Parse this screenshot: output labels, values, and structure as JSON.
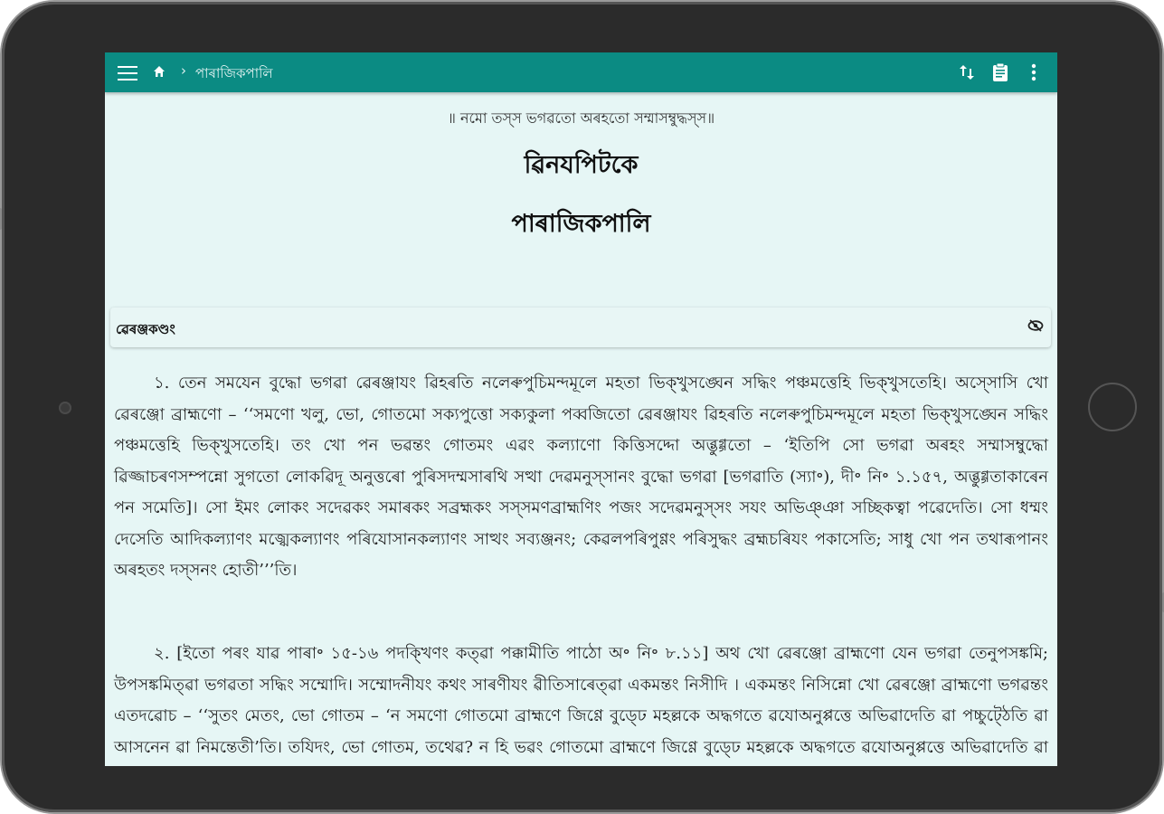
{
  "appbar": {
    "breadcrumb": "পাৰাজিকপালি",
    "separator": "›",
    "icons": [
      "menu-icon",
      "home-icon",
      "swap-vert-icon",
      "clipboard-icon",
      "more-vert-icon"
    ]
  },
  "header": {
    "namo": "॥ নমো তস্স ভগৱতো অৰহতো সম্মাসম্বুদ্ধস্স॥",
    "title": "ৱিনযপিটকে",
    "subtitle": "পাৰাজিকপালি"
  },
  "chapter": {
    "title": "ৱেৰঞ্জকণ্ডং"
  },
  "paragraphs": [
    "১. তেন সমযেন বুদ্ধো ভগৱা ৱেৰঞ্জাযং ৱিহৰতি নলেৰুপুচিমন্দমূলে মহতা ভিক্খুসঙ্ঘেন সদ্ধিং পঞ্চমত্তেহি ভিক্খুসতেহি। অস্সোসি খো ৱেৰঞ্জো ব্ৰাহ্মণো – ‘‘সমণো খলু, ভো, গোতমো সক্যপুত্তো সক্যকুলা পব্বজিতো ৱেৰঞ্জাযং ৱিহৰতি নলেৰুপুচিমন্দমূলে মহতা ভিক্খুসঙ্ঘেন সদ্ধিং পঞ্চমত্তেহি ভিক্খুসতেহি। তং খো পন ভৱন্তং গোতমং এৱং কল্যাণো কিত্তিসদ্দো অব্ভুগ্গতো – ‘ইতিপি সো ভগৱা অৰহং সম্মাসম্বুদ্ধো ৱিজ্জাচৰণসম্পন্নো সুগতো লোকৱিদূ অনুত্তৰো পুৰিসদম্মসাৰথি সত্থা দেৱমনুস্সানং বুদ্ধো ভগৱা [ভগৱাতি (স্যা॰), দী॰ নি॰ ১.১৫৭, অব্ভুগ্গতাকাৰেন পন সমেতি]। সো ইমং লোকং সদেৱকং সমাৰকং সব্ৰহ্মকং সস্সমণব্ৰাহ্মণিং পজং সদেৱমনুস্সং সযং অভিঞ্ঞা সচ্ছিকত্বা পৱেদেতি। সো ধম্মং দেসেতি আদিকল্যাণং মজ্ঝেকল্যাণং পৰিযোসানকল্যাণং সাত্থং সব্যঞ্জনং; কেৱলপৰিপুণ্ণং পৰিসুদ্ধং ব্ৰহ্মচৰিযং পকাসেতি; সাধু খো পন তথাৰূপানং অৰহতং দস্সনং হোতী’’’তি।",
    "২. [ইতো পৰং যাৱ পাৰা॰ ১৫-১৬ পদক্খিণং কত্ৱা পক্কামীতি পাঠো অ॰ নি॰ ৮.১১] অথ খো ৱেৰঞ্জো ব্ৰাহ্মণো যেন ভগৱা তেনুপসঙ্কমি; উপসঙ্কমিত্ৱা ভগৱতা সদ্ধিং সম্মোদি। সম্মোদনীযং কথং সাৰণীযং ৱীতিসাৰেত্ৱা একমন্তং নিসীদি । একমন্তং নিসিন্নো খো ৱেৰঞ্জো ব্ৰাহ্মণো ভগৱন্তং এতদৱোচ – ‘‘সুতং মেতং, ভো গোতম – ‘ন সমণো গোতমো ব্ৰাহ্মণে জিণ্ণে বুড্ঢে মহল্লকে অদ্ধগতে ৱযোঅনুপ্পত্তে অভিৱাদেতি ৱা পচ্চুট্ঠেতি ৱা আসনেন ৱা নিমন্তেতী’তি। তযিদং, ভো গোতম, তথেৱ? ন হি ভৱং গোতমো ব্ৰাহ্মণে জিণ্ণে বুড্ঢে মহল্লকে অদ্ধগতে ৱযোঅনুপ্পত্তে অভিৱাদেতি ৱা পচ্চুট্ঠেতি ৱা আসনেন ৱা নিমন্তেতি।"
  ]
}
